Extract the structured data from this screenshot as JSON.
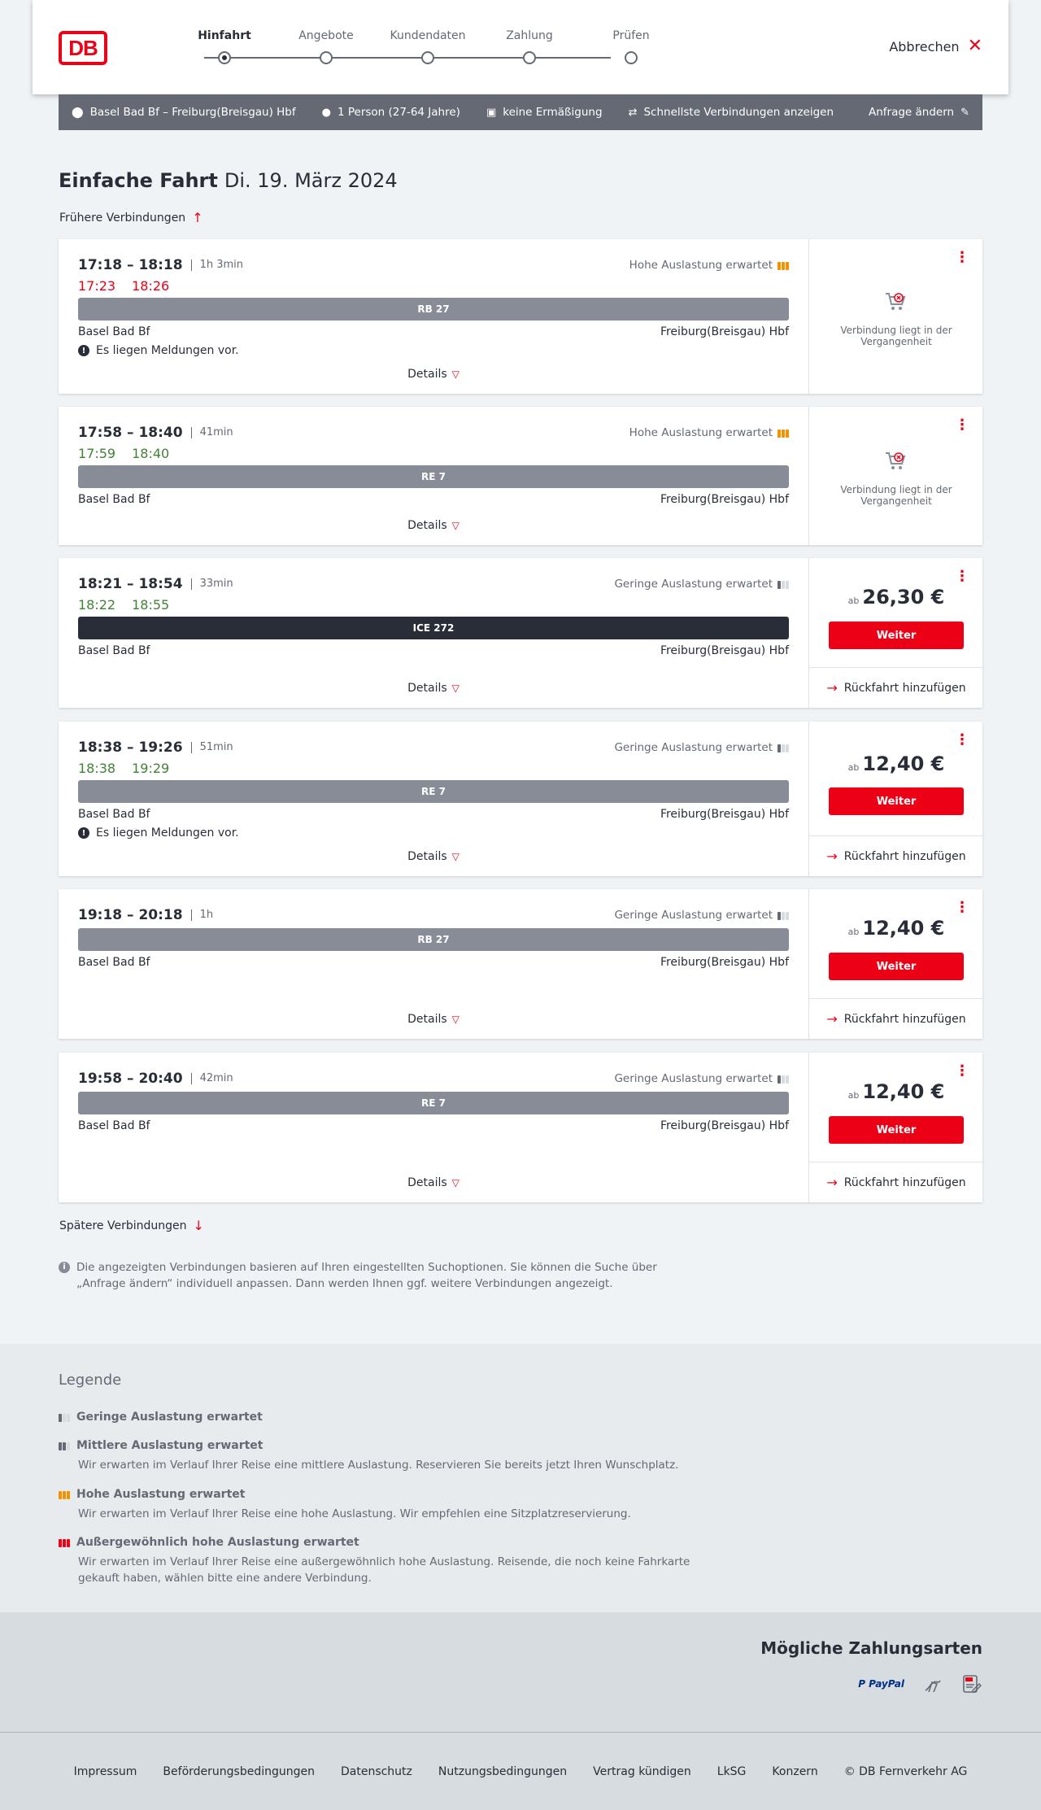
{
  "header": {
    "logo": "DB",
    "steps": [
      "Hinfahrt",
      "Angebote",
      "Kundendaten",
      "Zahlung",
      "Prüfen"
    ],
    "active_step": 0,
    "cancel_label": "Abbrechen"
  },
  "summary": {
    "route": "Basel Bad Bf – Freiburg(Breisgau) Hbf",
    "travellers": "1 Person (27-64 Jahre)",
    "discount": "keine Ermäßigung",
    "fastest": "Schnellste Verbindungen anzeigen",
    "change": "Anfrage ändern"
  },
  "page": {
    "title": "Einfache Fahrt",
    "date": "Di. 19. März 2024",
    "earlier": "Frühere Verbindungen",
    "later": "Spätere Verbindungen",
    "details": "Details",
    "past_text": "Verbindung liegt in der Vergangenheit",
    "weiter": "Weiter",
    "return": "Rückfahrt hinzufügen",
    "price_prefix": "ab",
    "message": "Es liegen Meldungen vor."
  },
  "connections": [
    {
      "times": "17:18 – 18:18",
      "duration": "1h 3min",
      "rt_dep": "17:23",
      "rt_arr": "18:26",
      "delay": true,
      "load": "Hohe Auslastung erwartet",
      "train": "RB 27",
      "from": "Basel Bad Bf",
      "to": "Freiburg(Breisgau) Hbf",
      "message": true,
      "past": true
    },
    {
      "times": "17:58 – 18:40",
      "duration": "41min",
      "rt_dep": "17:59",
      "rt_arr": "18:40",
      "delay": false,
      "load": "Hohe Auslastung erwartet",
      "train": "RE 7",
      "from": "Basel Bad Bf",
      "to": "Freiburg(Breisgau) Hbf",
      "message": false,
      "past": true
    },
    {
      "times": "18:21 – 18:54",
      "duration": "33min",
      "rt_dep": "18:22",
      "rt_arr": "18:55",
      "delay": false,
      "load": "Geringe Auslastung erwartet",
      "train": "ICE 272",
      "from": "Basel Bad Bf",
      "to": "Freiburg(Breisgau) Hbf",
      "message": false,
      "price": "26,30 €"
    },
    {
      "times": "18:38 – 19:26",
      "duration": "51min",
      "rt_dep": "18:38",
      "rt_arr": "19:29",
      "delay": false,
      "load": "Geringe Auslastung erwartet",
      "train": "RE 7",
      "from": "Basel Bad Bf",
      "to": "Freiburg(Breisgau) Hbf",
      "message": true,
      "price": "12,40 €"
    },
    {
      "times": "19:18 – 20:18",
      "duration": "1h",
      "load": "Geringe Auslastung erwartet",
      "train": "RB 27",
      "from": "Basel Bad Bf",
      "to": "Freiburg(Breisgau) Hbf",
      "message": false,
      "price": "12,40 €"
    },
    {
      "times": "19:58 – 20:40",
      "duration": "42min",
      "load": "Geringe Auslastung erwartet",
      "train": "RE 7",
      "from": "Basel Bad Bf",
      "to": "Freiburg(Breisgau) Hbf",
      "message": false,
      "price": "12,40 €"
    }
  ],
  "note": "Die angezeigten Verbindungen basieren auf Ihren eingestellten Suchoptionen. Sie können die Suche über „Anfrage ändern“ individuell anpassen. Dann werden Ihnen ggf. weitere Verbindungen angezeigt.",
  "legend": {
    "title": "Legende",
    "items": [
      {
        "title": "Geringe Auslastung erwartet",
        "desc": ""
      },
      {
        "title": "Mittlere Auslastung erwartet",
        "desc": "Wir erwarten im Verlauf Ihrer Reise eine mittlere Auslastung. Reservieren Sie bereits jetzt Ihren Wunschplatz."
      },
      {
        "title": "Hohe Auslastung erwartet",
        "desc": "Wir erwarten im Verlauf Ihrer Reise eine hohe Auslastung. Wir empfehlen eine Sitzplatzreservierung."
      },
      {
        "title": "Außergewöhnlich hohe Auslastung erwartet",
        "desc": "Wir erwarten im Verlauf Ihrer Reise eine außergewöhnlich hohe Auslastung. Reisende, die noch keine Fahrkarte gekauft haben, wählen bitte eine andere Verbindung."
      }
    ]
  },
  "payment": {
    "title": "Mögliche Zahlungsarten",
    "paypal_a": "P PayPal",
    "icons": [
      "paypal-icon",
      "creditcard-icon",
      "sepa-icon"
    ]
  },
  "footer": {
    "links": [
      "Impressum",
      "Beförderungsbedingungen",
      "Datenschutz",
      "Nutzungsbedingungen",
      "Vertrag kündigen",
      "LkSG",
      "Konzern",
      "© DB Fernverkehr AG"
    ]
  },
  "colors": {
    "brand": "#ec0016",
    "ontime": "#408335",
    "high_load": "#f39200"
  }
}
